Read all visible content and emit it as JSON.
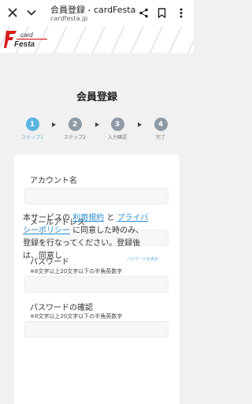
{
  "browser": {
    "title": "会員登録 - cardFesta",
    "url": "cardfesta.jp"
  },
  "brand": {
    "logo_text_top": "card",
    "logo_text_bottom": "Festa",
    "accent": "#d81e1e"
  },
  "page": {
    "title": "会員登録"
  },
  "steps": [
    {
      "num": "1",
      "label": "ステップ1"
    },
    {
      "num": "2",
      "label": "ステップ2"
    },
    {
      "num": "3",
      "label": "入力確認"
    },
    {
      "num": "4",
      "label": "完了"
    }
  ],
  "form": {
    "account": {
      "label": "アカウント名",
      "value": ""
    },
    "email": {
      "label": "メールアドレス",
      "value": ""
    },
    "password": {
      "label": "パスワード",
      "note": "※8文字以上20文字以下の半角英数字",
      "show_label": "パスワードを表示",
      "value": ""
    },
    "password_confirm": {
      "label": "パスワードの確認",
      "note": "※8文字以上20文字以下の半角英数字",
      "value": ""
    }
  },
  "terms": {
    "prefix": "本サービスの ",
    "terms_link": "利用規約",
    "mid": " と ",
    "privacy_link": "プライバシーポリシー",
    "suffix": " に同意した時のみ、登録を行なってください。登録後は、同意し"
  },
  "colors": {
    "step_active": "#5ab4e0",
    "step_inactive": "#8e9aa5",
    "link": "#2a8ed6"
  }
}
